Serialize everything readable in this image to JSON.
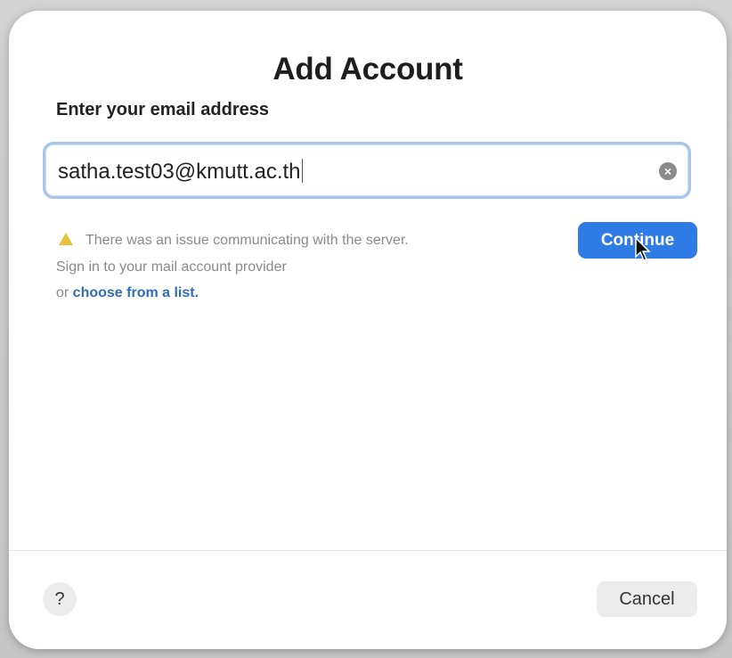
{
  "dialog": {
    "title": "Add Account",
    "prompt": "Enter your email address"
  },
  "email": {
    "value": "satha.test03@kmutt.ac.th",
    "clear_icon": "clear-circle-icon"
  },
  "error": {
    "icon": "warning-triangle-icon",
    "line1": "There was an issue communicating with the server.",
    "line2": "Sign in to your mail account provider",
    "line3_prefix": "or ",
    "line3_link": "choose from a list."
  },
  "buttons": {
    "continue": "Continue",
    "help": "?",
    "cancel": "Cancel"
  },
  "colors": {
    "accent": "#2f7be6",
    "link": "#2f6db9",
    "warning": "#e8c13a",
    "focus_ring": "#a7c4ea"
  }
}
